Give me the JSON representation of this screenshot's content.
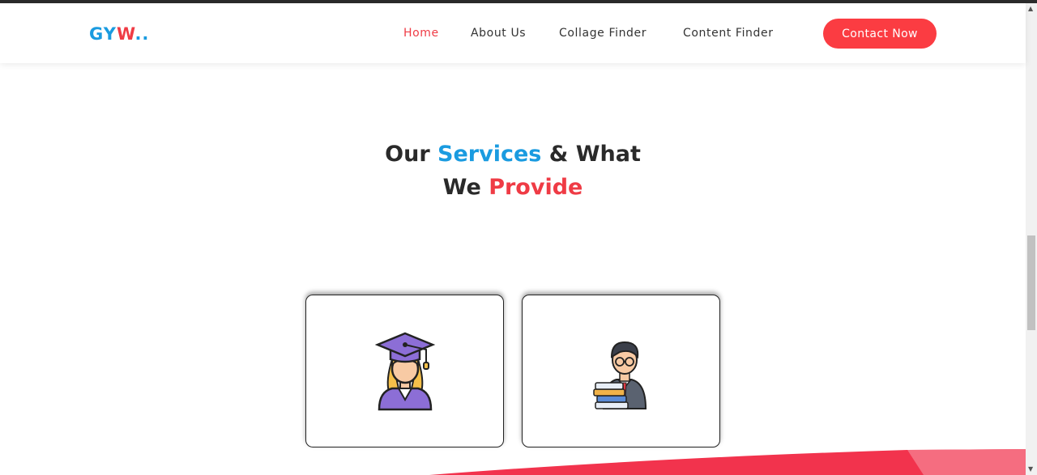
{
  "logo": {
    "part1": "GY",
    "part2": "W",
    "part3": ".."
  },
  "nav": {
    "home": "Home",
    "about": "About Us",
    "college_finder": "Collage Finder",
    "content_finder": "Content Finder",
    "contact_button": "Contact Now"
  },
  "heading": {
    "w1": "Our",
    "w2": "Services",
    "w3": "& What",
    "w4": "We",
    "w5": "Provide"
  },
  "cards": [
    {
      "icon": "graduate-student-icon"
    },
    {
      "icon": "teacher-with-books-icon"
    }
  ],
  "colors": {
    "accent_blue": "#1a9be0",
    "accent_red": "#ef3b45",
    "button_red": "#fb3c42"
  }
}
